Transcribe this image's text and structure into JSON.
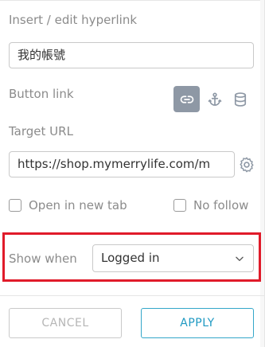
{
  "panel": {
    "title": "Insert / edit hyperlink",
    "link_text_value": "我的帳號",
    "button_link_label": "Button link",
    "link_type_icons": [
      "link-icon",
      "anchor-icon",
      "database-icon"
    ],
    "target_url_label": "Target URL",
    "target_url_value": "https://shop.mymerrylife.com/m",
    "open_new_tab_label": "Open in new tab",
    "no_follow_label": "No follow",
    "show_when_label": "Show when",
    "show_when_value": "Logged in",
    "cancel_label": "CANCEL",
    "apply_label": "APPLY"
  },
  "colors": {
    "accent": "#34a7c9",
    "highlight": "#e01b2a",
    "active_icon_bg": "#8e98a5"
  }
}
